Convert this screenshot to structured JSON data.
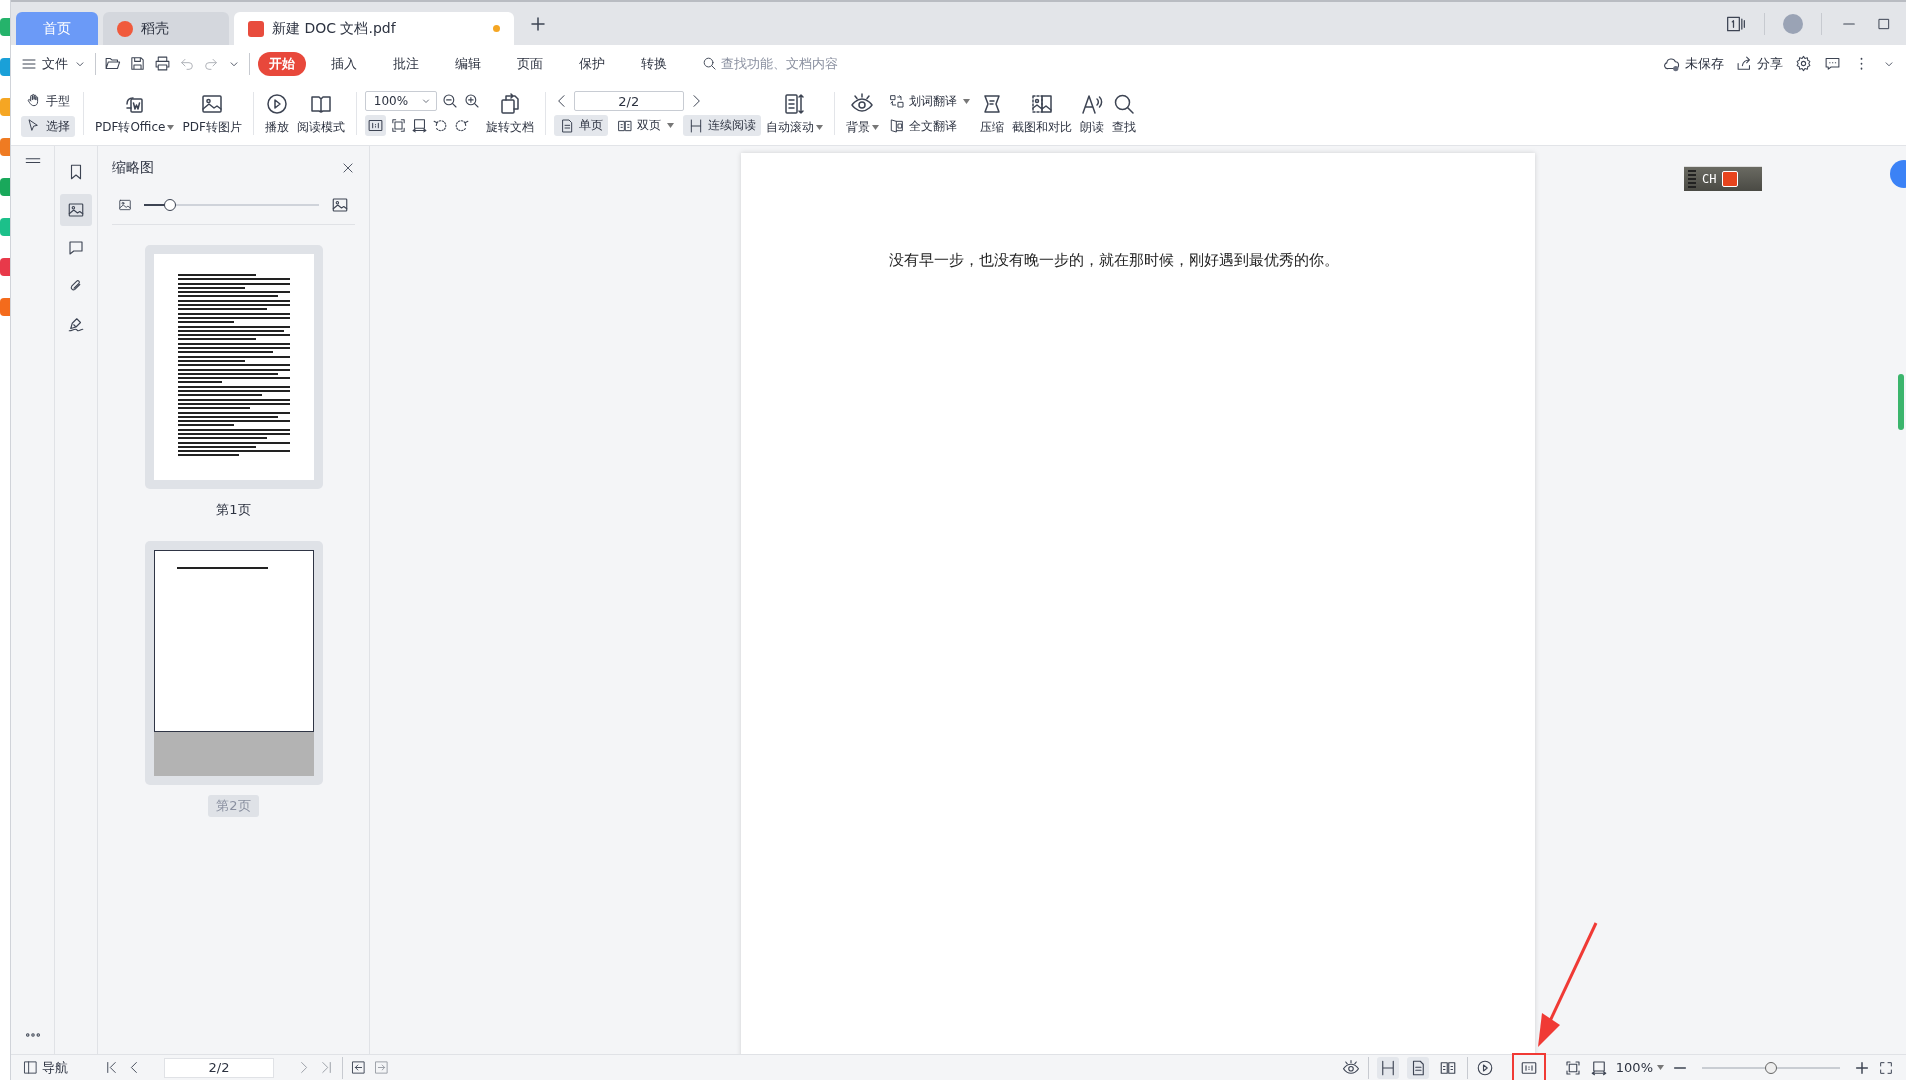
{
  "tabs": [
    {
      "label": "首页",
      "kind": "home",
      "selected": false
    },
    {
      "label": "稻壳",
      "kind": "app",
      "selected": false
    },
    {
      "label": "新建 DOC 文档.pdf",
      "kind": "doc",
      "selected": true,
      "unsaved": true
    }
  ],
  "menu": {
    "file": "文件",
    "items": [
      {
        "label": "开始",
        "selected": true
      },
      {
        "label": "插入",
        "selected": false
      },
      {
        "label": "批注",
        "selected": false
      },
      {
        "label": "编辑",
        "selected": false
      },
      {
        "label": "页面",
        "selected": false
      },
      {
        "label": "保护",
        "selected": false
      },
      {
        "label": "转换",
        "selected": false
      }
    ],
    "search_placeholder": "查找功能、文档内容",
    "save_status": "未保存",
    "share": "分享"
  },
  "ribbon": {
    "mode": [
      {
        "label": "手型",
        "selected": false
      },
      {
        "label": "选择",
        "selected": true
      }
    ],
    "convert": [
      {
        "label": "PDF转Office",
        "dropdown": true
      },
      {
        "label": "PDF转图片",
        "dropdown": false
      }
    ],
    "view": [
      {
        "label": "播放"
      },
      {
        "label": "阅读模式"
      }
    ],
    "zoom": {
      "value": "100%",
      "actual_size_selected": true
    },
    "rotate": {
      "label": "旋转文档"
    },
    "page": {
      "value": "2/2",
      "layouts": [
        {
          "label": "单页",
          "selected": true,
          "dropdown": false
        },
        {
          "label": "双页",
          "selected": false,
          "dropdown": true
        },
        {
          "label": "连续阅读",
          "selected": true,
          "dropdown": false
        }
      ]
    },
    "auto_scroll": {
      "label": "自动滚动",
      "dropdown": true
    },
    "background": {
      "label": "背景",
      "dropdown": true
    },
    "translate": [
      {
        "label": "划词翻译",
        "dropdown": true
      },
      {
        "label": "全文翻译",
        "dropdown": false
      }
    ],
    "tools": [
      {
        "label": "压缩"
      },
      {
        "label": "截图和对比"
      },
      {
        "label": "朗读"
      },
      {
        "label": "查找"
      }
    ]
  },
  "sidebar": {
    "icons": [
      {
        "selected": false
      },
      {
        "selected": true
      },
      {
        "selected": false
      },
      {
        "selected": false
      },
      {
        "selected": false
      }
    ]
  },
  "thumbnails": {
    "title": "缩略图",
    "level": 0.15,
    "pages": [
      {
        "label": "第1页",
        "kind": "full-text",
        "selected": false
      },
      {
        "label": "第2页",
        "kind": "one-line",
        "selected": true
      }
    ]
  },
  "document": {
    "text": "没有早一步，也没有晚一步的，就在那时候，刚好遇到最优秀的你。"
  },
  "ime": {
    "label": "CH"
  },
  "status": {
    "nav": "导航",
    "page": "2/2",
    "layouts": [
      {
        "selected": true
      },
      {
        "selected": true
      },
      {
        "selected": false
      }
    ],
    "zoom": "100%",
    "level": 0.5
  }
}
